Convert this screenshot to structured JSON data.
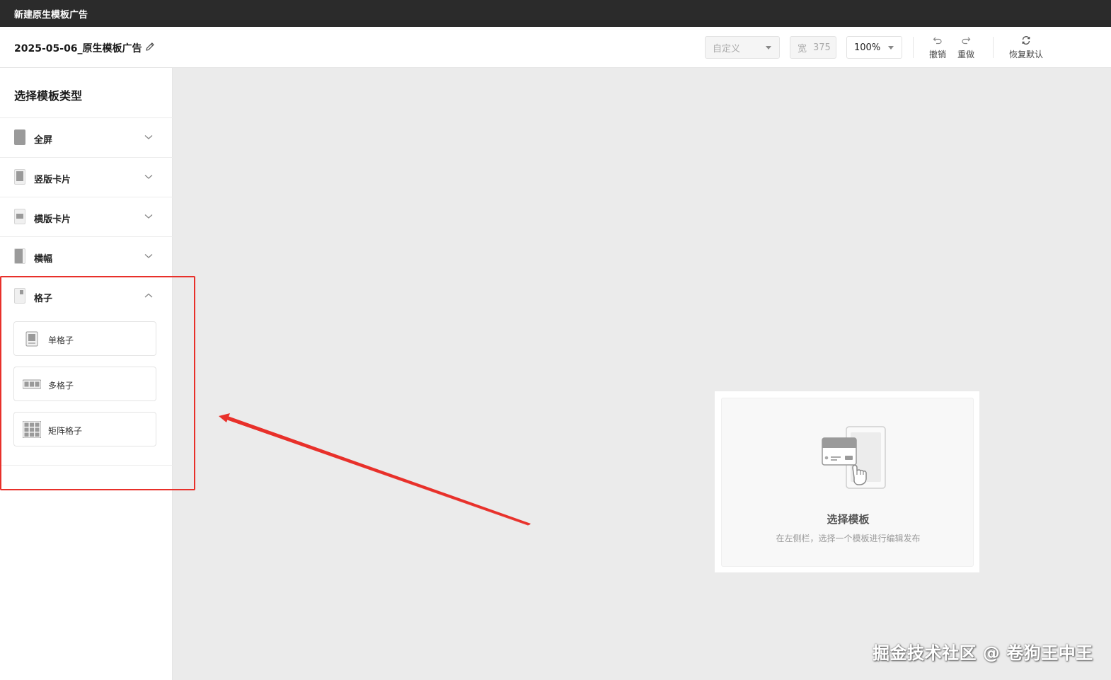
{
  "window": {
    "title": "新建原生模板广告"
  },
  "toolbar": {
    "doc_title": "2025-05-06_原生模板广告",
    "preset_select": {
      "value": "自定义"
    },
    "width_field": {
      "label": "宽",
      "value": "375"
    },
    "zoom_select": {
      "value": "100%"
    },
    "undo_label": "撤销",
    "redo_label": "重做",
    "restore_label": "恢复默认"
  },
  "sidebar": {
    "heading": "选择模板类型",
    "categories": [
      {
        "label": "全屏",
        "expanded": false
      },
      {
        "label": "竖版卡片",
        "expanded": false
      },
      {
        "label": "横版卡片",
        "expanded": false
      },
      {
        "label": "横幅",
        "expanded": false
      },
      {
        "label": "格子",
        "expanded": true
      }
    ],
    "grid_options": [
      {
        "label": "单格子"
      },
      {
        "label": "多格子"
      },
      {
        "label": "矩阵格子"
      }
    ]
  },
  "preview": {
    "title": "选择模板",
    "hint": "在左侧栏，选择一个模板进行编辑发布"
  },
  "watermark": "掘金技术社区 @ 卷狗王中王",
  "colors": {
    "titlebar": "#2b2b2b",
    "annotation": "#e8302a",
    "canvas": "#ebebeb"
  }
}
